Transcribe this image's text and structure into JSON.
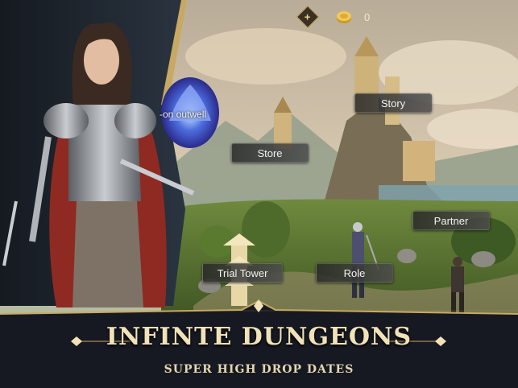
{
  "hud": {
    "plus_icon": "plus-icon",
    "coin_icon": "gold-coin-icon",
    "coin_count": "0"
  },
  "map_buttons": {
    "story": "Story",
    "store": "Store",
    "partner": "Partner",
    "trial_tower": "Trial Tower",
    "role": "Role"
  },
  "event_label": "-on outwell",
  "banner": {
    "title": "INFINTE DUNGEONS",
    "subtitle": "SUPER HIGH DROP DATES"
  },
  "colors": {
    "gold": "#c8a962",
    "banner_bg": "#161922",
    "text_cream": "#f1e2b8"
  }
}
